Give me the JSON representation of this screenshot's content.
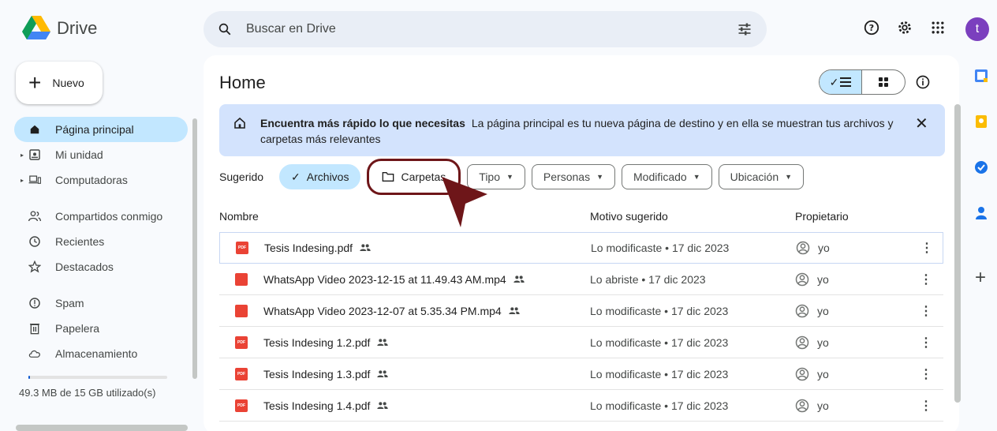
{
  "header": {
    "app_name": "Drive",
    "search_placeholder": "Buscar en Drive",
    "avatar_letter": "t"
  },
  "sidebar": {
    "new_label": "Nuevo",
    "items": [
      {
        "label": "Página principal",
        "icon": "home-icon"
      },
      {
        "label": "Mi unidad",
        "icon": "my-drive-icon"
      },
      {
        "label": "Computadoras",
        "icon": "computer-icon"
      },
      {
        "label": "Compartidos conmigo",
        "icon": "people-icon"
      },
      {
        "label": "Recientes",
        "icon": "clock-icon"
      },
      {
        "label": "Destacados",
        "icon": "star-icon"
      },
      {
        "label": "Spam",
        "icon": "spam-icon"
      },
      {
        "label": "Papelera",
        "icon": "trash-icon"
      },
      {
        "label": "Almacenamiento",
        "icon": "cloud-icon"
      }
    ],
    "storage_text": "49.3 MB de 15 GB utilizado(s)",
    "storage_fraction": 0.0033
  },
  "main": {
    "title": "Home",
    "banner": {
      "title": "Encuentra más rápido lo que necesitas",
      "text": "La página principal es tu nueva página de destino y en ella se muestran tus archivos y carpetas más relevantes"
    },
    "chips_label": "Sugerido",
    "chips": [
      "Archivos",
      "Carpetas",
      "Tipo",
      "Personas",
      "Modificado",
      "Ubicación"
    ],
    "columns": [
      "Nombre",
      "Motivo sugerido",
      "Propietario"
    ],
    "pdf_label": "PDF",
    "rows": [
      {
        "name": "Tesis Indesing.pdf",
        "type": "pdf",
        "reason": "Lo modificaste • 17 dic 2023",
        "owner": "yo"
      },
      {
        "name": "WhatsApp Video 2023-12-15 at 11.49.43 AM.mp4",
        "type": "video",
        "reason": "Lo abriste • 17 dic 2023",
        "owner": "yo"
      },
      {
        "name": "WhatsApp Video 2023-12-07 at 5.35.34 PM.mp4",
        "type": "video",
        "reason": "Lo modificaste • 17 dic 2023",
        "owner": "yo"
      },
      {
        "name": "Tesis Indesing 1.2.pdf",
        "type": "pdf",
        "reason": "Lo modificaste • 17 dic 2023",
        "owner": "yo"
      },
      {
        "name": "Tesis Indesing 1.3.pdf",
        "type": "pdf",
        "reason": "Lo modificaste • 17 dic 2023",
        "owner": "yo"
      },
      {
        "name": "Tesis Indesing 1.4.pdf",
        "type": "pdf",
        "reason": "Lo modificaste • 17 dic 2023",
        "owner": "yo"
      }
    ]
  },
  "colors": {
    "accent": "#c2e7ff",
    "banner": "#d3e3fd",
    "highlight": "#6e1619",
    "file_red": "#ea4335"
  }
}
